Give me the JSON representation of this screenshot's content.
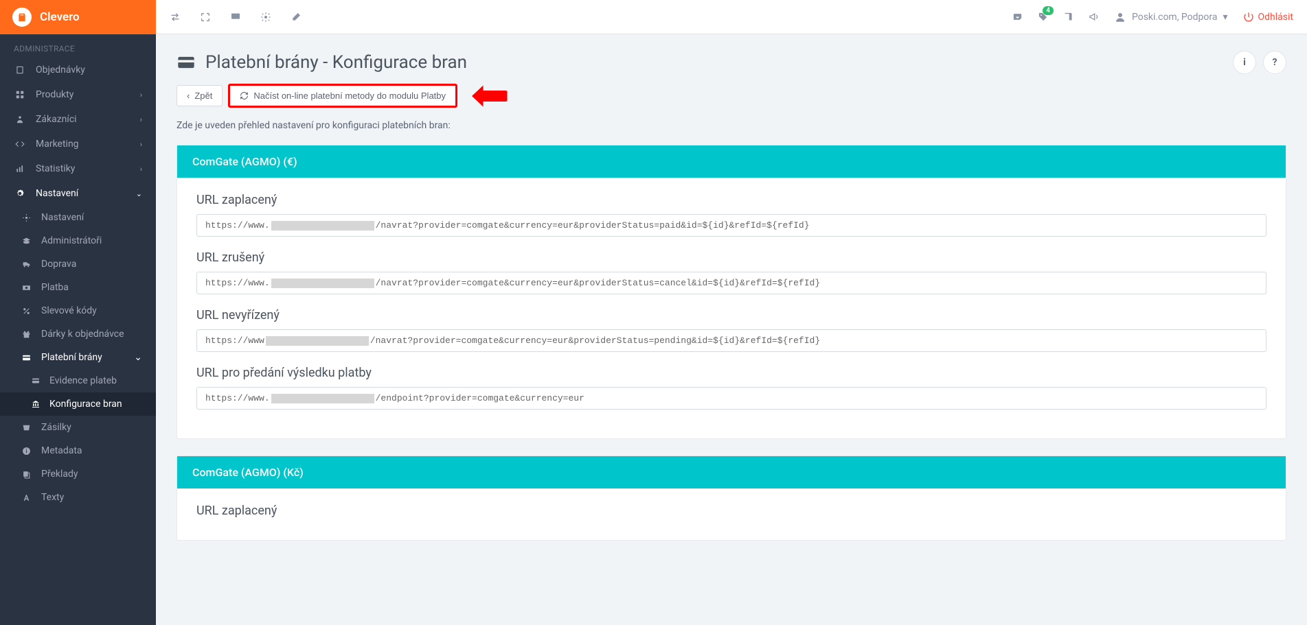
{
  "brand": "Clevero",
  "sidebar": {
    "section_label": "ADMINISTRACE",
    "items": [
      {
        "label": "Objednávky"
      },
      {
        "label": "Produkty",
        "expandable": true
      },
      {
        "label": "Zákazníci",
        "expandable": true
      },
      {
        "label": "Marketing",
        "expandable": true
      },
      {
        "label": "Statistiky",
        "expandable": true
      },
      {
        "label": "Nastavení",
        "expandable": true,
        "active": true
      }
    ],
    "subitems": [
      {
        "label": "Nastavení"
      },
      {
        "label": "Administrátoři"
      },
      {
        "label": "Doprava"
      },
      {
        "label": "Platba"
      },
      {
        "label": "Slevové kódy"
      },
      {
        "label": "Dárky k objednávce"
      },
      {
        "label": "Platební brány",
        "expandable": true,
        "active": true
      }
    ],
    "subsubitems": [
      {
        "label": "Evidence plateb"
      },
      {
        "label": "Konfigurace bran",
        "active": true
      }
    ],
    "tail_items": [
      {
        "label": "Zásilky"
      },
      {
        "label": "Metadata"
      },
      {
        "label": "Překlady"
      },
      {
        "label": "Texty"
      }
    ]
  },
  "header": {
    "badge_count": "4",
    "user_name": "Poski.com, Podpora",
    "logout_label": "Odhlásit"
  },
  "page": {
    "title": "Platební brány - Konfigurace bran",
    "back_label": "Zpět",
    "load_button_label": "Načíst on-line platební metody do modulu Platby",
    "description": "Zde je uveden přehled nastavení pro konfiguraci platebních bran:"
  },
  "panels": [
    {
      "title": "ComGate (AGMO) (€)",
      "fields": [
        {
          "label": "URL zaplacený",
          "prefix": "https://www.",
          "suffix": "/navrat?provider=comgate&currency=eur&providerStatus=paid&id=${id}&refId=${refId}"
        },
        {
          "label": "URL zrušený",
          "prefix": "https://www.",
          "suffix": "/navrat?provider=comgate&currency=eur&providerStatus=cancel&id=${id}&refId=${refId}"
        },
        {
          "label": "URL nevyřízený",
          "prefix": "https://www",
          "suffix": "/navrat?provider=comgate&currency=eur&providerStatus=pending&id=${id}&refId=${refId}"
        },
        {
          "label": "URL pro předání výsledku platby",
          "prefix": "https://www.",
          "suffix": "/endpoint?provider=comgate&currency=eur"
        }
      ]
    },
    {
      "title": "ComGate (AGMO) (Kč)",
      "fields": [
        {
          "label": "URL zaplacený"
        }
      ]
    }
  ]
}
